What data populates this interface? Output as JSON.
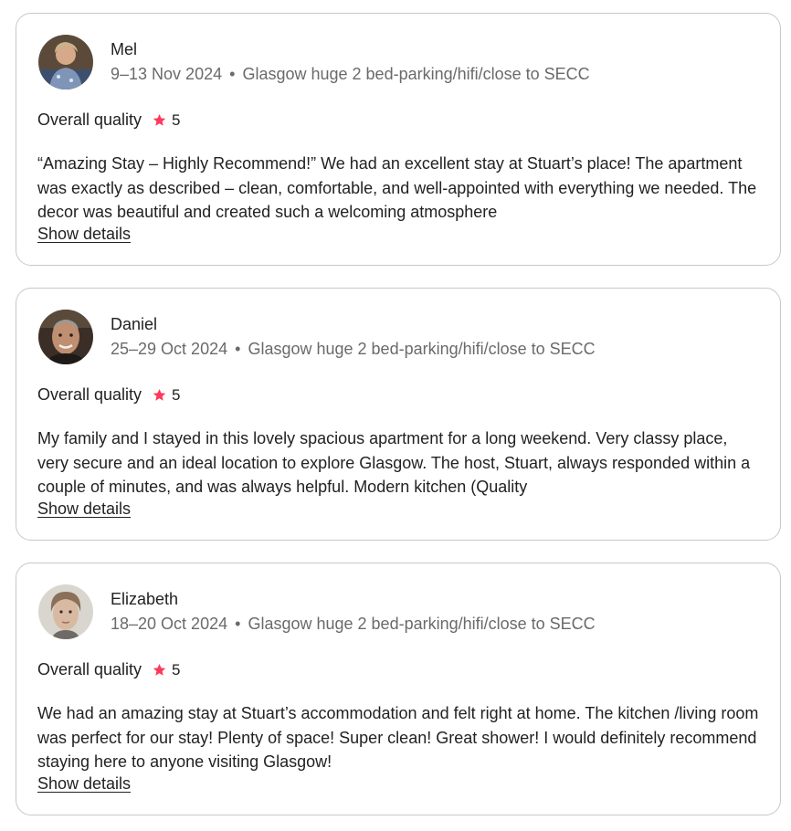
{
  "reviews": [
    {
      "name": "Mel",
      "dates": "9–13 Nov 2024",
      "listing": "Glasgow huge 2 bed-parking/hifi/close to SECC",
      "quality_label": "Overall quality",
      "rating": "5",
      "text": "“Amazing Stay – Highly Recommend!” We had an excellent stay at Stuart’s place! The apartment was exactly as described – clean, comfortable, and well-appointed with everything we needed. The decor was beautiful and created such a welcoming atmosphere",
      "show_details": "Show details"
    },
    {
      "name": "Daniel",
      "dates": "25–29 Oct 2024",
      "listing": "Glasgow huge 2 bed-parking/hifi/close to SECC",
      "quality_label": "Overall quality",
      "rating": "5",
      "text": "My family and I stayed in this lovely spacious apartment for a long weekend. Very classy place, very secure and an ideal location to explore Glasgow. The host, Stuart, always responded within a couple of minutes, and was always helpful. Modern kitchen (Quality",
      "show_details": "Show details"
    },
    {
      "name": "Elizabeth",
      "dates": "18–20 Oct 2024",
      "listing": "Glasgow huge 2 bed-parking/hifi/close to SECC",
      "quality_label": "Overall quality",
      "rating": "5",
      "text": "We had an amazing stay at Stuart’s accommodation and felt right at home. The kitchen /living room was perfect for our stay! Plenty of space! Super clean! Great shower! I would definitely recommend staying here to anyone visiting Glasgow!",
      "show_details": "Show details"
    }
  ],
  "separator": "•",
  "icons": {
    "star": "star-icon"
  },
  "colors": {
    "star": "#ff385c",
    "meta_text": "#6a6a6a",
    "primary_text": "#222222",
    "card_border": "#c8c8c8"
  }
}
